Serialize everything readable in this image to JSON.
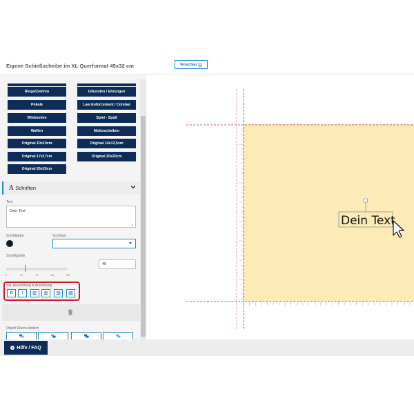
{
  "header": {
    "title": "Eigene Schießscheibe im XL Querformat 45x32 cm",
    "preview_label": "Vorschau"
  },
  "categories": [
    "Ringe/Zentren",
    "Urkunden / Ehrungen",
    "Pokale",
    "Law Enforcement / Combat",
    "Wildmotive",
    "Spiel - Spaß",
    "Waffen",
    "Mottoscheiben",
    "Original 10x10cm",
    "Original 14x13,5cm",
    "Original 17x17cm",
    "Original 20x20cm",
    "Original 26x26cm"
  ],
  "fonts_section": {
    "icon": "A",
    "title": "Schriften",
    "text_label": "Text",
    "text_value": "Dein Text",
    "color_label": "Schriftfarbe",
    "color_value": "#0c1a2c",
    "font_label": "Schriftart",
    "font_value": "",
    "size_label": "Schriftgröße",
    "size_value": "40",
    "size_ticks": [
      "8",
      "0n",
      "75",
      "111",
      "150"
    ],
    "size_slider_fraction": 0.3,
    "style_label": "Stil, Ausrichtung & Anordnung",
    "style_buttons": [
      "B",
      "I"
    ]
  },
  "layer": {
    "label": "Objekt Ebene ändern"
  },
  "help": {
    "label": "Hilfe / FAQ"
  },
  "canvas": {
    "target_color": "#fcebb6",
    "guide_color": "#e2515b",
    "text_object": "Dein Text"
  }
}
